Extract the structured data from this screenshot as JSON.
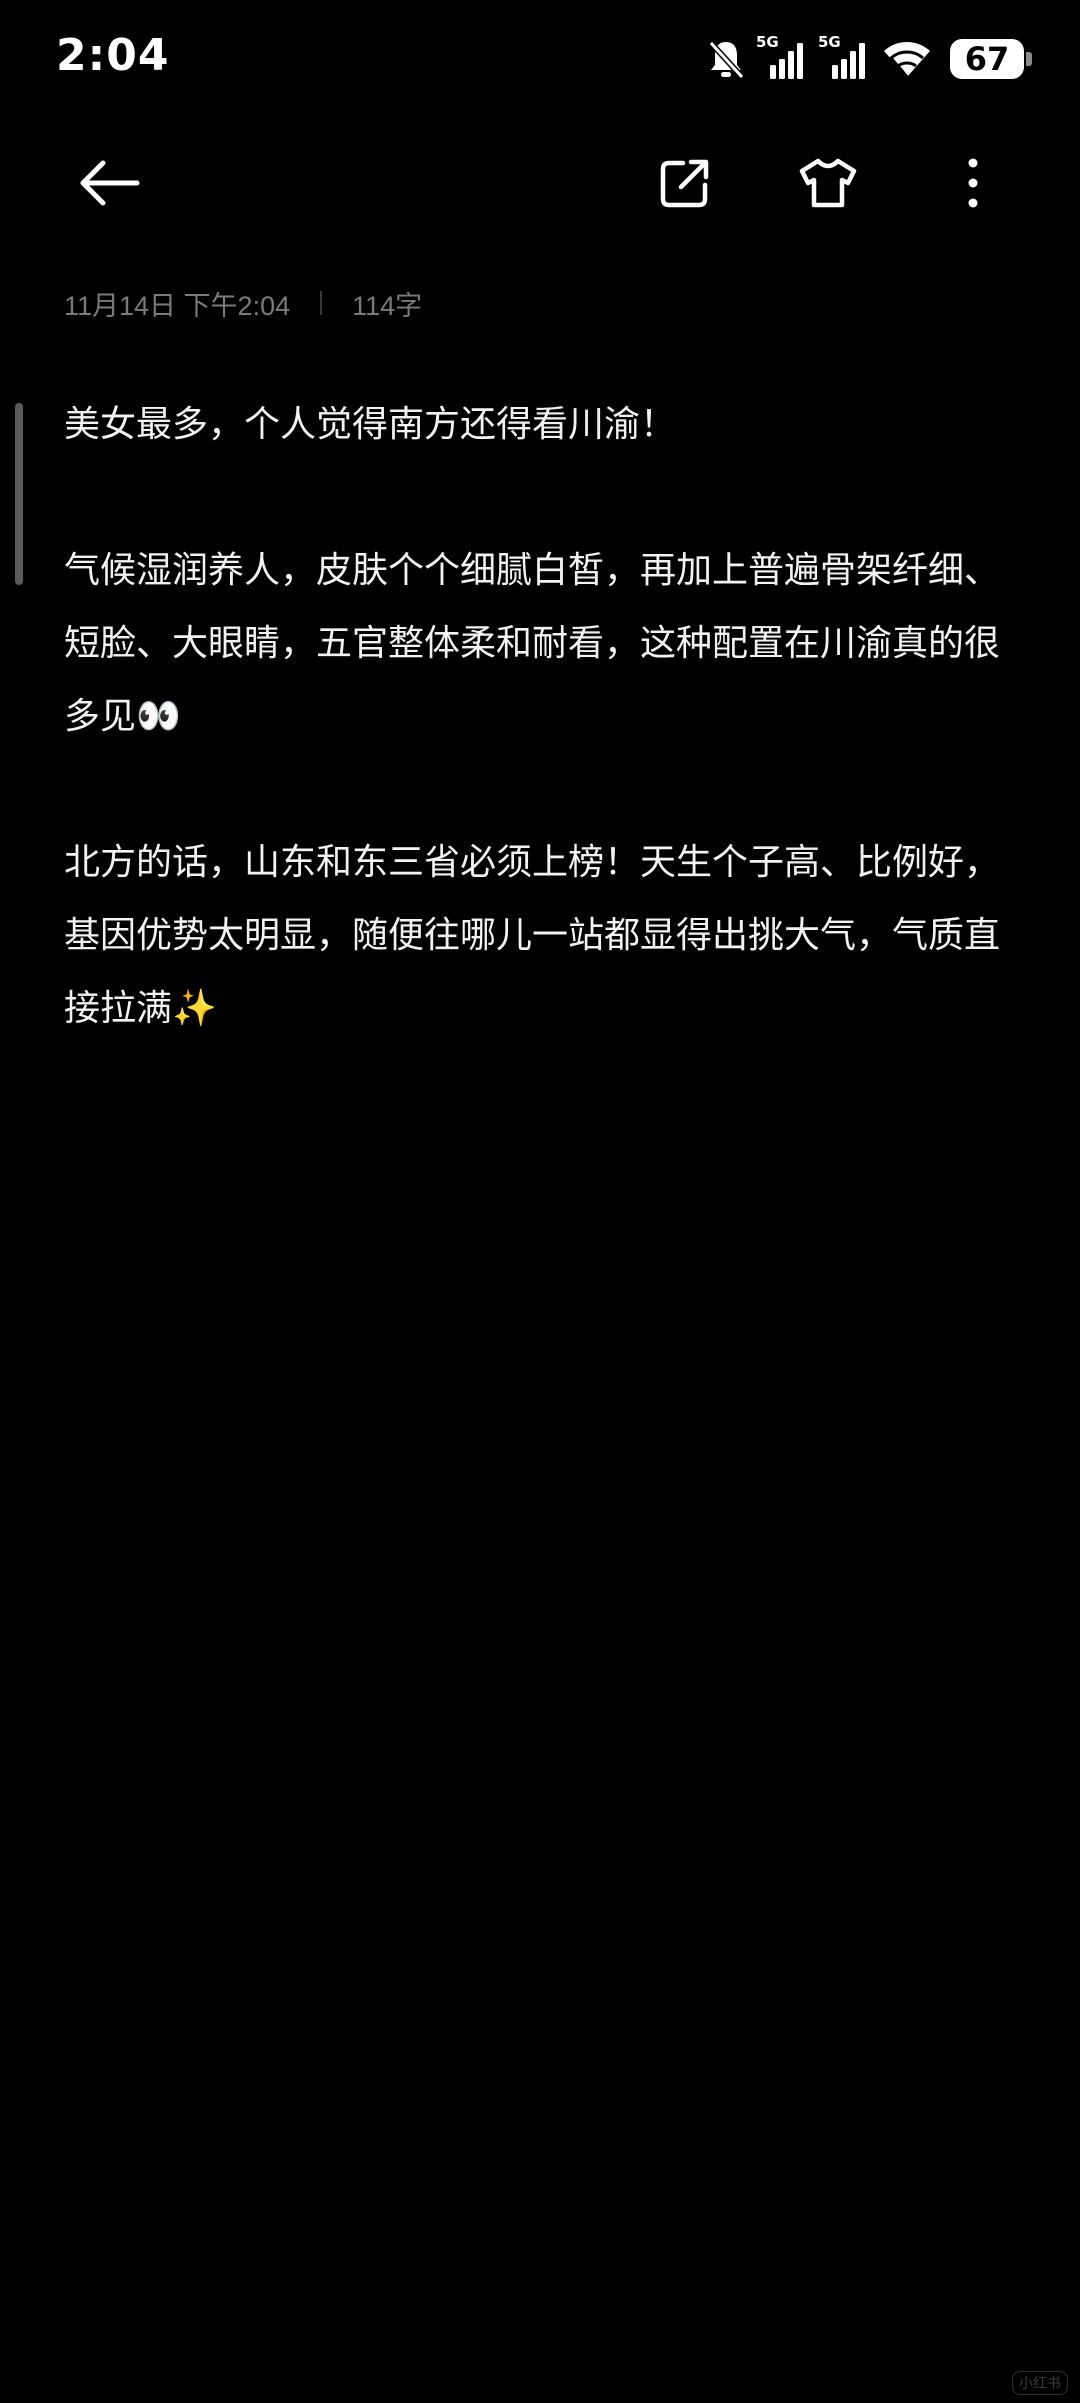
{
  "status_bar": {
    "time": "2:04",
    "network_1": "5G",
    "network_2": "5G",
    "battery": "67",
    "icons": [
      "bell-muted-icon",
      "signal-icon",
      "signal-icon",
      "wifi-icon",
      "battery-icon"
    ]
  },
  "toolbar": {
    "icons": [
      "back-arrow-icon",
      "share-icon",
      "theme-shirt-icon",
      "more-vertical-icon"
    ]
  },
  "note": {
    "date": "11月14日 下午2:04",
    "word_count": "114字",
    "paragraphs": [
      "美女最多，个人觉得南方还得看川渝！",
      "气候湿润养人，皮肤个个细腻白皙，再加上普遍骨架纤细、短脸、大眼睛，五官整体柔和耐看，这种配置在川渝真的很多见👀",
      "北方的话，山东和东三省必须上榜！天生个子高、比例好，基因优势太明显，随便往哪儿一站都显得出挑大气，气质直接拉满✨"
    ]
  },
  "watermark": "小红书",
  "colors": {
    "background": "#000000",
    "text": "#f2f2f2",
    "meta": "#7a7a7a"
  }
}
